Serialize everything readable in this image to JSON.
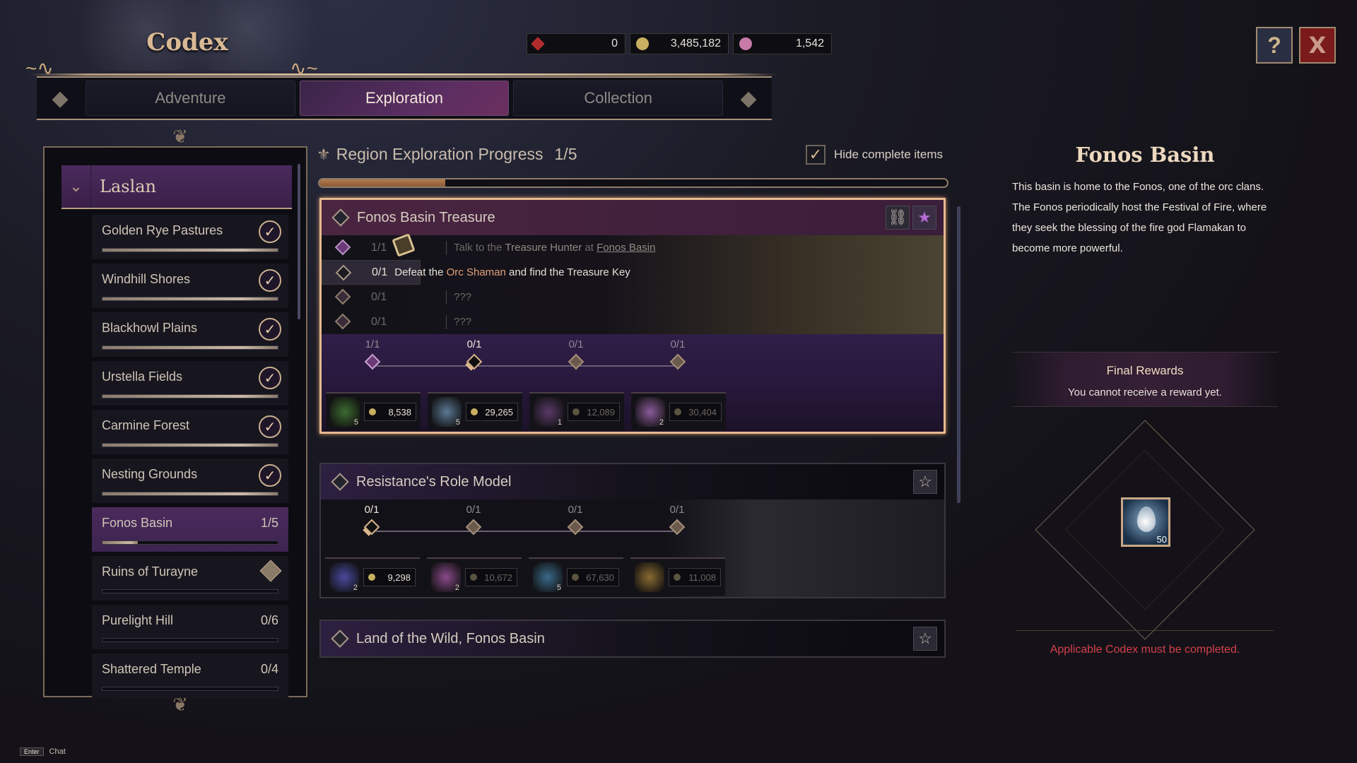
{
  "header": {
    "title": "Codex",
    "tabs": [
      {
        "label": "Adventure",
        "active": false
      },
      {
        "label": "Exploration",
        "active": true
      },
      {
        "label": "Collection",
        "active": false
      }
    ],
    "currency": [
      {
        "icon": "ticket-icon",
        "value": "0",
        "color": "#b02c2c"
      },
      {
        "icon": "gold-coin-icon",
        "value": "3,485,182",
        "color": "#c8b060"
      },
      {
        "icon": "pink-gem-icon",
        "value": "1,542",
        "color": "#c87aa8"
      }
    ],
    "help_button": "?",
    "close_button": "X"
  },
  "sidebar": {
    "region": {
      "name": "Laslan",
      "expanded": true
    },
    "items": [
      {
        "name": "Golden Rye Pastures",
        "status": "complete",
        "progress": 1.0
      },
      {
        "name": "Windhill Shores",
        "status": "complete",
        "progress": 1.0
      },
      {
        "name": "Blackhowl Plains",
        "status": "complete",
        "progress": 1.0
      },
      {
        "name": "Urstella Fields",
        "status": "complete",
        "progress": 1.0
      },
      {
        "name": "Carmine Forest",
        "status": "complete",
        "progress": 1.0
      },
      {
        "name": "Nesting Grounds",
        "status": "complete",
        "progress": 1.0
      },
      {
        "name": "Fonos Basin",
        "status": "active",
        "count": "1/5",
        "progress": 0.2
      },
      {
        "name": "Ruins of Turayne",
        "status": "locked",
        "progress": 0
      },
      {
        "name": "Purelight Hill",
        "status": "open",
        "count": "0/6",
        "progress": 0
      },
      {
        "name": "Shattered Temple",
        "status": "open",
        "count": "0/4",
        "progress": 0
      }
    ]
  },
  "main": {
    "progress_title": "Region Exploration Progress",
    "progress_count": "1/5",
    "progress_value": 0.2,
    "hide_complete_label": "Hide complete items",
    "hide_complete_checked": true,
    "cards": [
      {
        "title": "Fonos Basin Treasure",
        "selected": true,
        "favorite": true,
        "has_link": true,
        "tasks": [
          {
            "progress": "1/1",
            "state": "done",
            "parts": [
              "Talk to the ",
              "Treasure Hunter",
              " at ",
              "Fonos Basin"
            ]
          },
          {
            "progress": "0/1",
            "state": "current",
            "parts": [
              "Defeat the ",
              "Orc Shaman",
              " and find the Treasure Key"
            ]
          },
          {
            "progress": "0/1",
            "state": "locked",
            "parts": [
              "???"
            ]
          },
          {
            "progress": "0/1",
            "state": "locked",
            "parts": [
              "???"
            ]
          }
        ],
        "milestones": [
          {
            "label": "1/1",
            "state": "done",
            "reward_qty": "5",
            "gold": "8,538",
            "item_color": "#3c6a30"
          },
          {
            "label": "0/1",
            "state": "current",
            "reward_qty": "5",
            "gold": "29,265",
            "item_color": "#5a7894"
          },
          {
            "label": "0/1",
            "state": "locked",
            "reward_qty": "1",
            "gold": "12,089",
            "item_color": "#5a3a6a"
          },
          {
            "label": "0/1",
            "state": "locked",
            "reward_qty": "2",
            "gold": "30,404",
            "item_color": "#8a5a9a"
          }
        ]
      },
      {
        "title": "Resistance's Role Model",
        "selected": false,
        "favorite": false,
        "milestones": [
          {
            "label": "0/1",
            "state": "current",
            "reward_qty": "2",
            "gold": "9,298",
            "item_color": "#4a4aa0"
          },
          {
            "label": "0/1",
            "state": "locked",
            "reward_qty": "2",
            "gold": "10,672",
            "item_color": "#8a4a8a"
          },
          {
            "label": "0/1",
            "state": "locked",
            "reward_qty": "5",
            "gold": "67,630",
            "item_color": "#3a6a8a"
          },
          {
            "label": "0/1",
            "state": "locked",
            "reward_qty": "",
            "gold": "11,008",
            "item_color": "#8a6a30"
          }
        ]
      },
      {
        "title": "Land of the Wild, Fonos Basin",
        "selected": false,
        "favorite": false
      }
    ]
  },
  "info": {
    "title": "Fonos Basin",
    "description": "This basin is home to the Fonos, one of the orc clans. The Fonos periodically host the Festival of Fire, where they seek the blessing of the fire god Flamakan to become more powerful.",
    "final_rewards_title": "Final Rewards",
    "final_rewards_status": "You cannot receive a reward yet.",
    "final_item_qty": "50",
    "warning": "Applicable Codex must be completed."
  },
  "footer": {
    "key": "Enter",
    "action": "Chat"
  }
}
